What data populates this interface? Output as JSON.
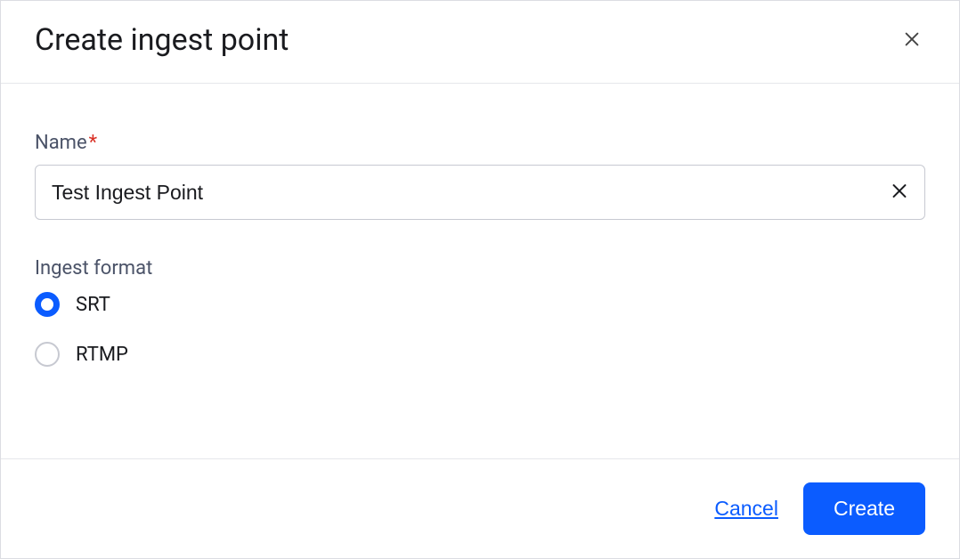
{
  "modal": {
    "title": "Create ingest point"
  },
  "form": {
    "name": {
      "label": "Name",
      "required_marker": "*",
      "value": "Test Ingest Point"
    },
    "ingest_format": {
      "label": "Ingest format",
      "options": [
        {
          "label": "SRT",
          "selected": true
        },
        {
          "label": "RTMP",
          "selected": false
        }
      ]
    }
  },
  "footer": {
    "cancel": "Cancel",
    "create": "Create"
  }
}
